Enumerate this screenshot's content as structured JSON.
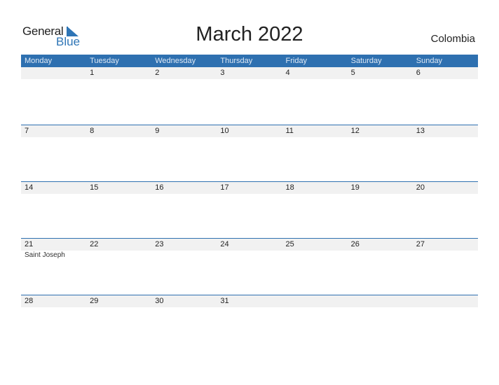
{
  "brand": {
    "line1": "General",
    "line2": "Blue",
    "accent": "#2e75b6"
  },
  "title": "March 2022",
  "country": "Colombia",
  "header_color": "#2e70b0",
  "weekdays": [
    "Monday",
    "Tuesday",
    "Wednesday",
    "Thursday",
    "Friday",
    "Saturday",
    "Sunday"
  ],
  "weeks": [
    {
      "days": [
        "",
        "1",
        "2",
        "3",
        "4",
        "5",
        "6"
      ],
      "events": [
        "",
        "",
        "",
        "",
        "",
        "",
        ""
      ]
    },
    {
      "days": [
        "7",
        "8",
        "9",
        "10",
        "11",
        "12",
        "13"
      ],
      "events": [
        "",
        "",
        "",
        "",
        "",
        "",
        ""
      ]
    },
    {
      "days": [
        "14",
        "15",
        "16",
        "17",
        "18",
        "19",
        "20"
      ],
      "events": [
        "",
        "",
        "",
        "",
        "",
        "",
        ""
      ]
    },
    {
      "days": [
        "21",
        "22",
        "23",
        "24",
        "25",
        "26",
        "27"
      ],
      "events": [
        "Saint Joseph",
        "",
        "",
        "",
        "",
        "",
        ""
      ]
    },
    {
      "days": [
        "28",
        "29",
        "30",
        "31",
        "",
        "",
        ""
      ],
      "events": [
        "",
        "",
        "",
        "",
        "",
        "",
        ""
      ]
    }
  ]
}
